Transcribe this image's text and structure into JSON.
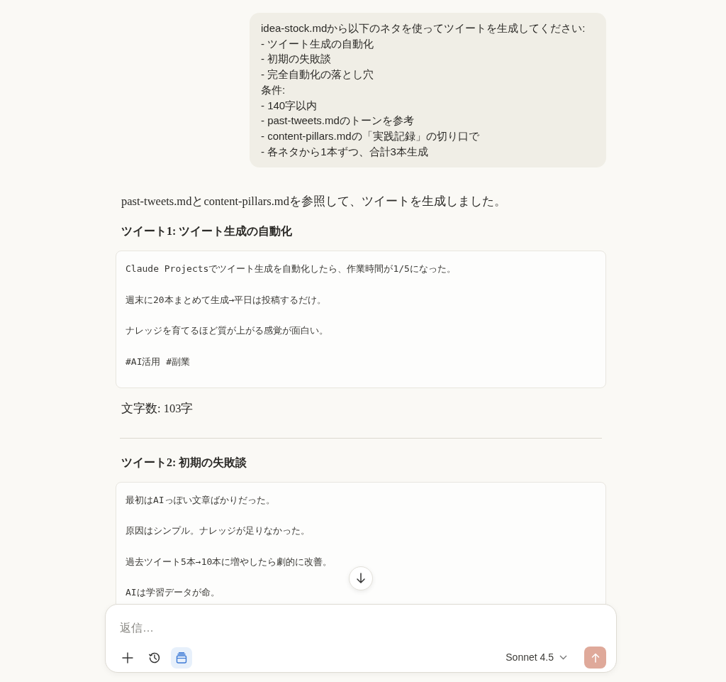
{
  "user_message": {
    "lines": [
      "idea-stock.mdから以下のネタを使ってツイートを生成してください:",
      "- ツイート生成の自動化",
      "- 初期の失敗談",
      "- 完全自動化の落とし穴",
      "条件:",
      "- 140字以内",
      "- past-tweets.mdのトーンを参考",
      "- content-pillars.mdの「実践記録」の切り口で",
      "- 各ネタから1本ずつ、合計3本生成"
    ]
  },
  "assistant": {
    "intro": "past-tweets.mdとcontent-pillars.mdを参照して、ツイートを生成しました。",
    "sections": [
      {
        "heading": "ツイート1: ツイート生成の自動化",
        "tweet_lines": [
          "Claude Projectsでツイート生成を自動化したら、作業時間が1/5になった。",
          "週末に20本まとめて生成→平日は投稿するだけ。",
          "ナレッジを育てるほど質が上がる感覚が面白い。",
          "#AI活用 #副業"
        ],
        "char_count": "文字数: 103字"
      },
      {
        "heading": "ツイート2: 初期の失敗談",
        "tweet_lines": [
          "最初はAIっぽい文章ばかりだった。",
          "原因はシンプル。ナレッジが足りなかった。",
          "過去ツイート5本→10本に増やしたら劇的に改善。",
          "AIは学習データが命。"
        ]
      }
    ]
  },
  "composer": {
    "placeholder": "返信…",
    "tools": [
      {
        "kind": "add",
        "active": false
      },
      {
        "kind": "history",
        "active": false
      },
      {
        "kind": "project",
        "active": true
      }
    ],
    "model": "Sonnet 4.5"
  }
}
